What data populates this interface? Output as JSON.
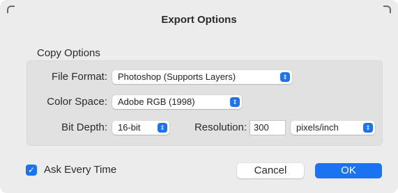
{
  "dialog": {
    "title": "Export Options",
    "section_label": "Copy Options",
    "file_format": {
      "label": "File Format:",
      "value": "Photoshop (Supports Layers)"
    },
    "color_space": {
      "label": "Color Space:",
      "value": "Adobe RGB (1998)"
    },
    "bit_depth": {
      "label": "Bit Depth:",
      "value": "16-bit"
    },
    "resolution": {
      "label": "Resolution:",
      "value": "300",
      "unit": "pixels/inch"
    },
    "ask_every_time": {
      "label": "Ask Every Time",
      "checked": true
    },
    "cancel_label": "Cancel",
    "ok_label": "OK",
    "accent_color": "#1a73f0"
  }
}
